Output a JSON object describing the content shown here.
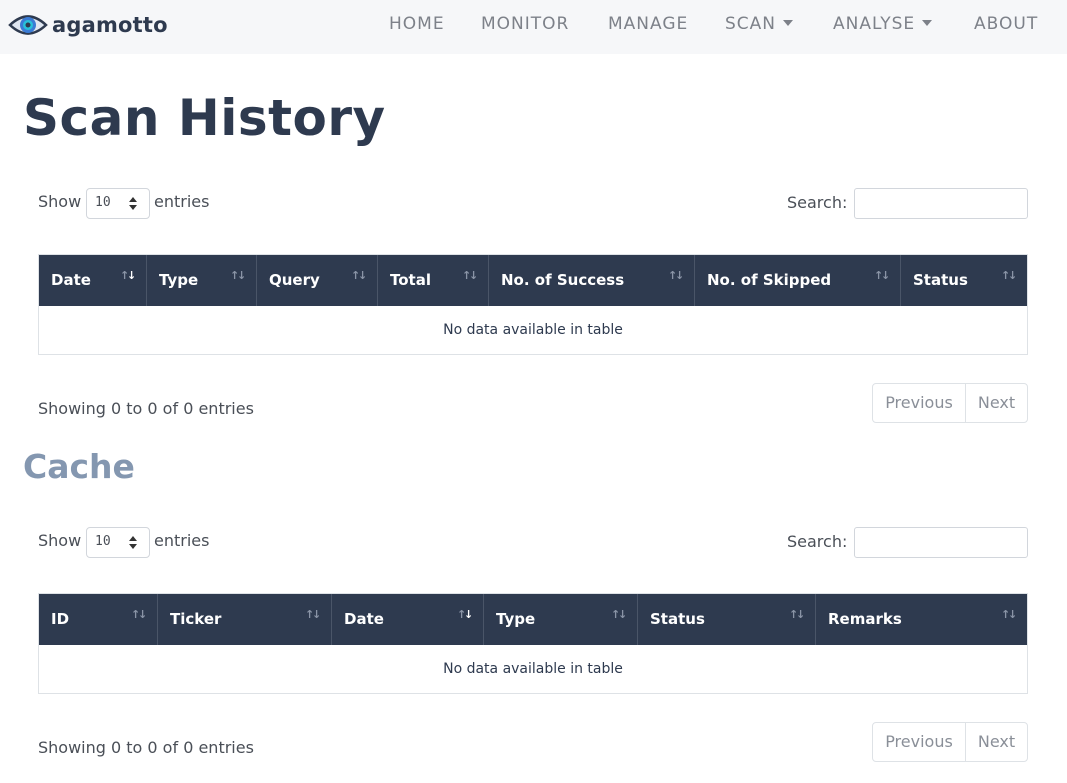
{
  "brand": {
    "name": "agamotto"
  },
  "nav": {
    "home": "HOME",
    "monitor": "MONITOR",
    "manage": "MANAGE",
    "scan": "SCAN",
    "analyse": "ANALYSE",
    "about": "ABOUT"
  },
  "scan_history": {
    "title": "Scan History",
    "show_label": "Show",
    "entries_value": "10",
    "entries_label": "entries",
    "search_label": "Search:",
    "search_value": "",
    "columns": [
      "Date",
      "Type",
      "Query",
      "Total",
      "No. of Success",
      "No. of Skipped",
      "Status"
    ],
    "empty_message": "No data available in table",
    "info": "Showing 0 to 0 of 0 entries",
    "prev_label": "Previous",
    "next_label": "Next"
  },
  "cache": {
    "title": "Cache",
    "show_label": "Show",
    "entries_value": "10",
    "entries_label": "entries",
    "search_label": "Search:",
    "search_value": "",
    "columns": [
      "ID",
      "Ticker",
      "Date",
      "Type",
      "Status",
      "Remarks"
    ],
    "empty_message": "No data available in table",
    "info": "Showing 0 to 0 of 0 entries",
    "prev_label": "Previous",
    "next_label": "Next"
  },
  "colors": {
    "navbar_bg": "#f6f7f9",
    "header_bg": "#2e3a4f",
    "title_dark": "#2e3a4f",
    "title_muted": "#8497b0"
  }
}
